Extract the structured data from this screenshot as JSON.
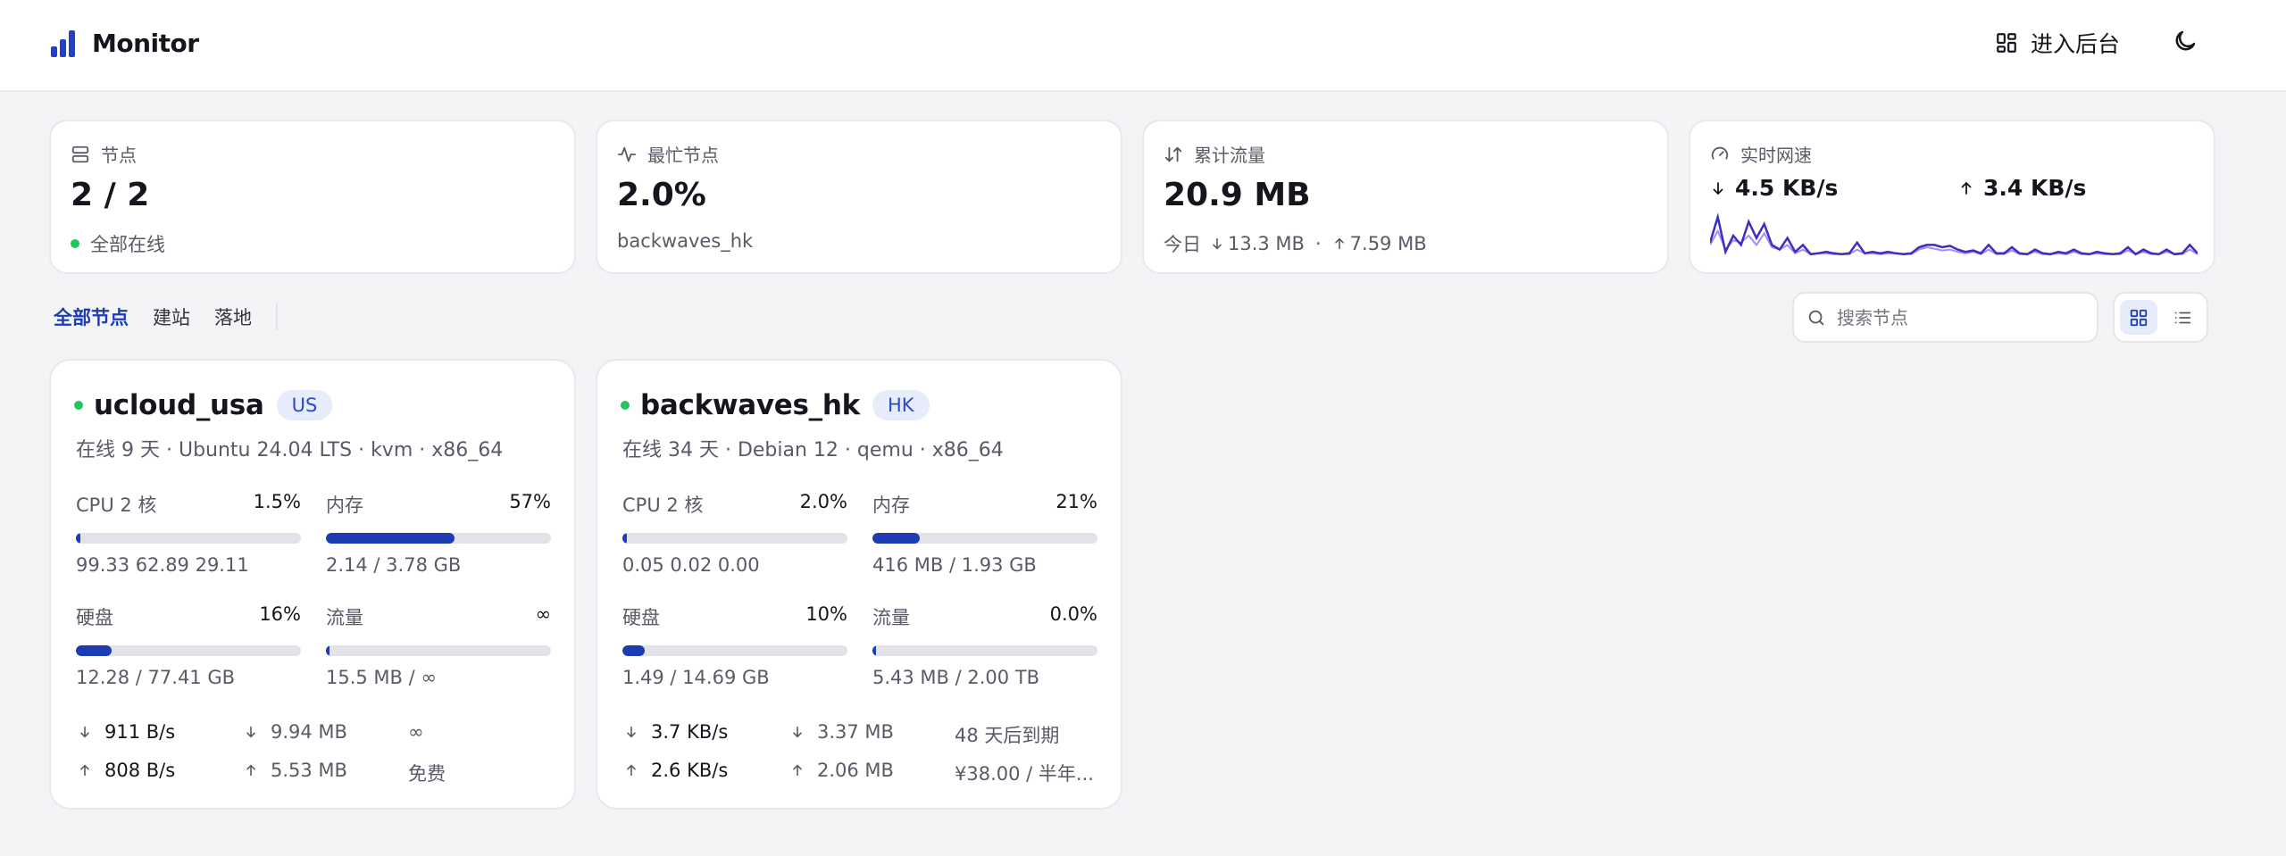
{
  "app": {
    "name": "Monitor"
  },
  "header": {
    "admin_label": "进入后台",
    "theme_icon": "moon-icon"
  },
  "stats": {
    "nodes": {
      "label": "节点",
      "value": "2 / 2",
      "sub": "全部在线"
    },
    "busiest": {
      "label": "最忙节点",
      "value": "2.0%",
      "sub": "backwaves_hk"
    },
    "traffic": {
      "label": "累计流量",
      "value": "20.9 MB",
      "today_label": "今日",
      "down": "13.3 MB",
      "dot": "·",
      "up": "7.59 MB"
    },
    "realtime": {
      "label": "实时网速",
      "down": "4.5 KB/s",
      "up": "3.4 KB/s",
      "sparkline_down": [
        0.35,
        0.9,
        0.15,
        0.5,
        0.3,
        0.8,
        0.45,
        0.75,
        0.3,
        0.2,
        0.45,
        0.15,
        0.3,
        0.1,
        0.12,
        0.15,
        0.12,
        0.1,
        0.12,
        0.35,
        0.12,
        0.15,
        0.12,
        0.15,
        0.12,
        0.1,
        0.12,
        0.25,
        0.3,
        0.3,
        0.25,
        0.28,
        0.2,
        0.15,
        0.18,
        0.12,
        0.3,
        0.12,
        0.12,
        0.25,
        0.12,
        0.1,
        0.2,
        0.12,
        0.1,
        0.15,
        0.12,
        0.2,
        0.12,
        0.1,
        0.15,
        0.12,
        0.1,
        0.12,
        0.25,
        0.1,
        0.2,
        0.12,
        0.1,
        0.2,
        0.1,
        0.12,
        0.3,
        0.12
      ],
      "sparkline_up": [
        0.3,
        0.6,
        0.2,
        0.4,
        0.35,
        0.5,
        0.3,
        0.55,
        0.25,
        0.2,
        0.3,
        0.12,
        0.2,
        0.1,
        0.12,
        0.12,
        0.1,
        0.1,
        0.1,
        0.2,
        0.12,
        0.12,
        0.1,
        0.12,
        0.12,
        0.1,
        0.1,
        0.2,
        0.25,
        0.22,
        0.18,
        0.2,
        0.15,
        0.12,
        0.15,
        0.1,
        0.2,
        0.1,
        0.1,
        0.18,
        0.1,
        0.1,
        0.15,
        0.1,
        0.1,
        0.12,
        0.1,
        0.15,
        0.1,
        0.1,
        0.12,
        0.1,
        0.1,
        0.1,
        0.18,
        0.1,
        0.15,
        0.1,
        0.1,
        0.15,
        0.1,
        0.1,
        0.2,
        0.1
      ]
    }
  },
  "filters": [
    "全部节点",
    "建站",
    "落地"
  ],
  "search": {
    "placeholder": "搜索节点"
  },
  "nodes": [
    {
      "name": "ucloud_usa",
      "region": "US",
      "meta": "在线 9 天 · Ubuntu 24.04 LTS · kvm · x86_64",
      "cpu": {
        "label": "CPU 2 核",
        "pct": "1.5%",
        "fill": 0.015,
        "sub": "99.33 62.89 29.11"
      },
      "mem": {
        "label": "内存",
        "pct": "57%",
        "fill": 0.57,
        "sub": "2.14 / 3.78 GB"
      },
      "disk": {
        "label": "硬盘",
        "pct": "16%",
        "fill": 0.16,
        "sub": "12.28 / 77.41 GB"
      },
      "traffic": {
        "label": "流量",
        "pct": "∞",
        "fill": 0,
        "sub": "15.5 MB / ∞"
      },
      "net_down": "911 B/s",
      "net_up": "808 B/s",
      "total_down": "9.94 MB",
      "total_up": "5.53 MB",
      "expire": "∞",
      "price": "免费"
    },
    {
      "name": "backwaves_hk",
      "region": "HK",
      "meta": "在线 34 天 · Debian 12 · qemu · x86_64",
      "cpu": {
        "label": "CPU 2 核",
        "pct": "2.0%",
        "fill": 0.02,
        "sub": "0.05 0.02 0.00"
      },
      "mem": {
        "label": "内存",
        "pct": "21%",
        "fill": 0.21,
        "sub": "416 MB / 1.93 GB"
      },
      "disk": {
        "label": "硬盘",
        "pct": "10%",
        "fill": 0.1,
        "sub": "1.49 / 14.69 GB"
      },
      "traffic": {
        "label": "流量",
        "pct": "0.0%",
        "fill": 0.0,
        "sub": "5.43 MB / 2.00 TB"
      },
      "net_down": "3.7 KB/s",
      "net_up": "2.6 KB/s",
      "total_down": "3.37 MB",
      "total_up": "2.06 MB",
      "expire": "48 天后到期",
      "price": "¥38.00 / 半年..."
    }
  ],
  "colors": {
    "accent": "#1d3cb4",
    "online": "#22c55e",
    "badge_bg": "#e7ecfb"
  }
}
